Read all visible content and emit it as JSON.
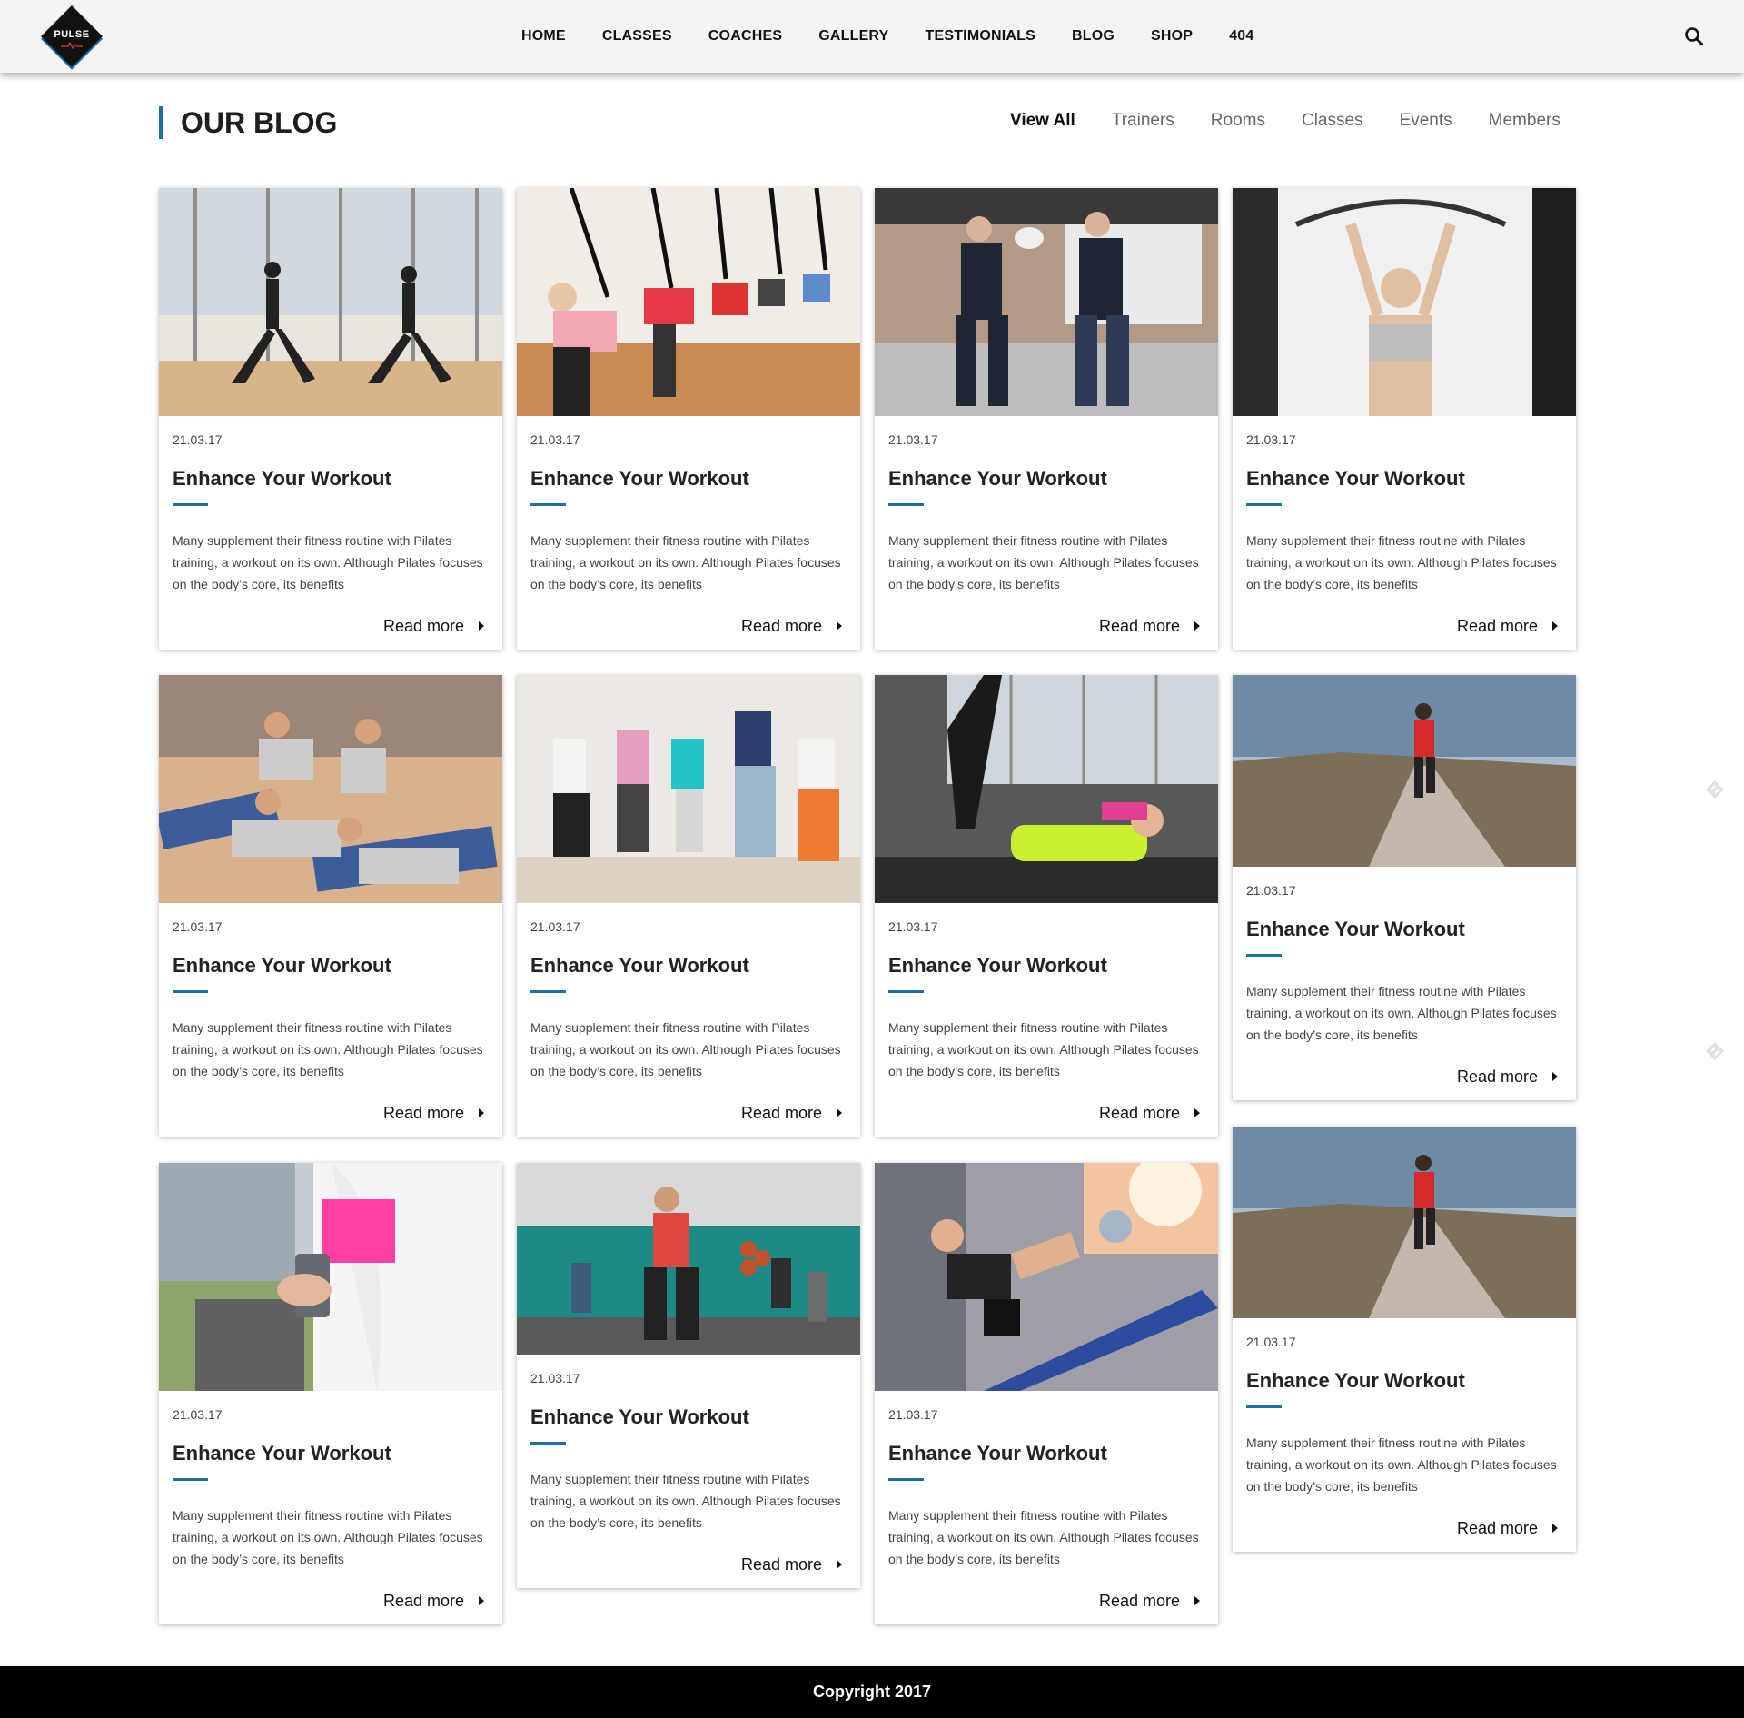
{
  "brand": {
    "logo_text": "PULSE"
  },
  "nav": {
    "items": [
      "HOME",
      "CLASSES",
      "COACHES",
      "GALLERY",
      "TESTIMONIALS",
      "BLOG",
      "SHOP",
      "404"
    ]
  },
  "header": {
    "search_icon": "search-icon"
  },
  "page": {
    "title": "OUR BLOG"
  },
  "filters": {
    "items": [
      "View All",
      "Trainers",
      "Rooms",
      "Classes",
      "Events",
      "Members"
    ],
    "active": "View All"
  },
  "posts": [
    {
      "date": "21.03.17",
      "title": "Enhance Your Workout",
      "excerpt": "Many supplement their fitness routine with Pilates training, a workout on its own. Although Pilates focuses on the body’s core, its benefits",
      "more": "Read more",
      "image": "yoga-pair-photo"
    },
    {
      "date": "21.03.17",
      "title": "Enhance Your Workout",
      "excerpt": "Many supplement their fitness routine with Pilates training, a workout on its own. Although Pilates focuses on the body’s core, its benefits",
      "more": "Read more",
      "image": "trx-class-photo"
    },
    {
      "date": "21.03.17",
      "title": "Enhance Your Workout",
      "excerpt": "Many supplement their fitness routine with Pilates training, a workout on its own. Although Pilates focuses on the body’s core, its benefits",
      "more": "Read more",
      "image": "boxing-pads-photo"
    },
    {
      "date": "21.03.17",
      "title": "Enhance Your Workout",
      "excerpt": "Many supplement their fitness routine with Pilates training, a workout on its own. Although Pilates focuses on the body’s core, its benefits",
      "more": "Read more",
      "image": "cable-pulldown-photo"
    },
    {
      "date": "21.03.17",
      "title": "Enhance Your Workout",
      "excerpt": "Many supplement their fitness routine with Pilates training, a workout on its own. Although Pilates focuses on the body’s core, its benefits",
      "more": "Read more",
      "image": "yoga-class-photo"
    },
    {
      "date": "21.03.17",
      "title": "Enhance Your Workout",
      "excerpt": "Many supplement their fitness routine with Pilates training, a workout on its own. Although Pilates focuses on the body’s core, its benefits",
      "more": "Read more",
      "image": "dance-class-photo"
    },
    {
      "date": "21.03.17",
      "title": "Enhance Your Workout",
      "excerpt": "Many supplement their fitness routine with Pilates training, a workout on its own. Although Pilates focuses on the body’s core, its benefits",
      "more": "Read more",
      "image": "pilates-reformer-photo"
    },
    {
      "date": "21.03.17",
      "title": "Enhance Your Workout",
      "excerpt": "Many supplement their fitness routine with Pilates training, a workout on its own. Although Pilates focuses on the body’s core, its benefits",
      "more": "Read more",
      "image": "road-runner-photo"
    },
    {
      "date": "21.03.17",
      "title": "Enhance Your Workout",
      "excerpt": "Many supplement their fitness routine with Pilates training, a workout on its own. Although Pilates focuses on the body’s core, its benefits",
      "more": "Read more",
      "image": "phone-runner-photo"
    },
    {
      "date": "21.03.17",
      "title": "Enhance Your Workout",
      "excerpt": "Many supplement their fitness routine with Pilates training, a workout on its own. Although Pilates focuses on the body’s core, its benefits",
      "more": "Read more",
      "image": "gym-class-photo"
    },
    {
      "date": "21.03.17",
      "title": "Enhance Your Workout",
      "excerpt": "Many supplement their fitness routine with Pilates training, a workout on its own. Although Pilates focuses on the body’s core, its benefits",
      "more": "Read more",
      "image": "situp-bench-photo"
    },
    {
      "date": "21.03.17",
      "title": "Enhance Your Workout",
      "excerpt": "Many supplement their fitness routine with Pilates training, a workout on its own. Although Pilates focuses on the body’s core, its benefits",
      "more": "Read more",
      "image": "road-runner-photo"
    }
  ],
  "footer": {
    "copyright": "Copyright 2017"
  },
  "colors": {
    "accent": "#1b6fae",
    "header_bg": "#f4f4f4",
    "footer_bg": "#000000"
  }
}
